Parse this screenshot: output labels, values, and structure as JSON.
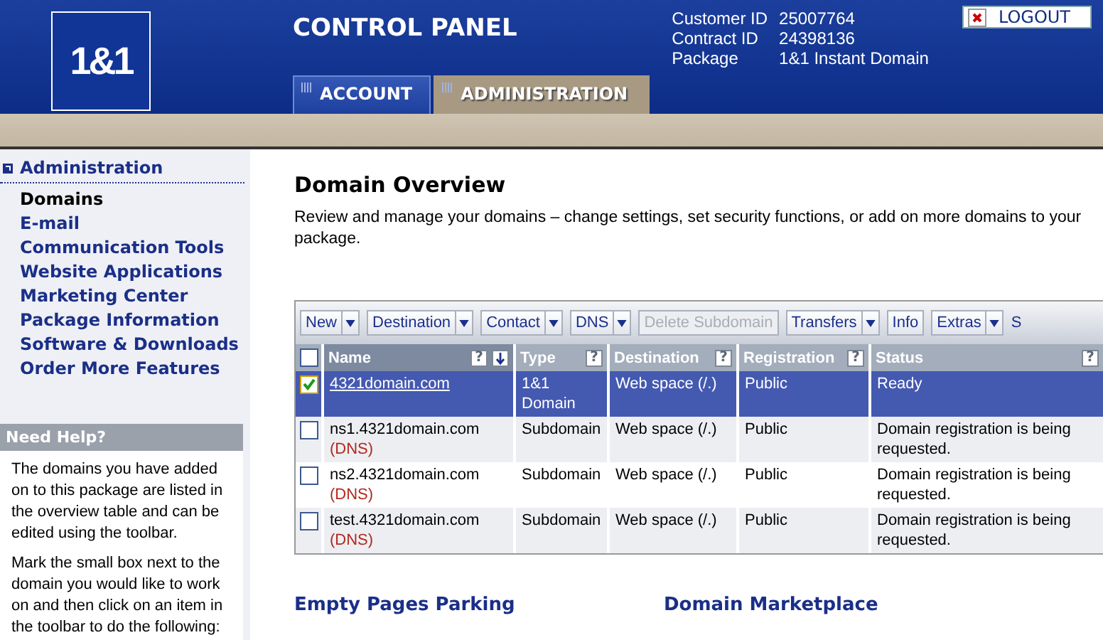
{
  "logo": {
    "text": "1&1"
  },
  "header": {
    "title": "CONTROL PANEL",
    "logout": "LOGOUT",
    "info": [
      {
        "label": "Customer ID",
        "value": "25007764"
      },
      {
        "label": "Contract ID",
        "value": "24398136"
      },
      {
        "label": "Package",
        "value": "1&1 Instant Domain"
      }
    ]
  },
  "tabs": [
    {
      "label": "ACCOUNT",
      "selected": false
    },
    {
      "label": "ADMINISTRATION",
      "selected": true
    }
  ],
  "sidebar": {
    "heading": "Administration",
    "items": [
      {
        "label": "Domains",
        "selected": true
      },
      {
        "label": "E-mail",
        "selected": false
      },
      {
        "label": "Communication Tools",
        "selected": false
      },
      {
        "label": "Website Applications",
        "selected": false
      },
      {
        "label": "Marketing Center",
        "selected": false
      },
      {
        "label": "Package Information",
        "selected": false
      },
      {
        "label": "Software & Downloads",
        "selected": false
      },
      {
        "label": "Order More Features",
        "selected": false
      }
    ],
    "help": {
      "title": "Need Help?",
      "paragraphs": [
        "The domains you have added on to this package are listed in the overview table and can be edited using the toolbar.",
        "Mark the small box next to the domain you would like to work on and then click on an item in the toolbar to do the following:"
      ]
    }
  },
  "main": {
    "title": "Domain Overview",
    "description": "Review and manage your domains – change settings, set security functions, or add on more domains to your package.",
    "toolbar": [
      {
        "kind": "button",
        "label": "New",
        "dropdown": true,
        "disabled": false
      },
      {
        "kind": "button",
        "label": "Destination",
        "dropdown": true,
        "disabled": false
      },
      {
        "kind": "button",
        "label": "Contact",
        "dropdown": true,
        "disabled": false
      },
      {
        "kind": "button",
        "label": "DNS",
        "dropdown": true,
        "disabled": false
      },
      {
        "kind": "button",
        "label": "Delete Subdomain",
        "dropdown": false,
        "disabled": true
      },
      {
        "kind": "button",
        "label": "Transfers",
        "dropdown": true,
        "disabled": false
      },
      {
        "kind": "button",
        "label": "Info",
        "dropdown": false,
        "disabled": false
      },
      {
        "kind": "button",
        "label": "Extras",
        "dropdown": true,
        "disabled": false
      },
      {
        "kind": "cut",
        "label": "S"
      }
    ],
    "table": {
      "all_checked": false,
      "help_glyph": "?",
      "columns": [
        {
          "label": "Name",
          "sort": true,
          "selected": true
        },
        {
          "label": "Type",
          "sort": false,
          "selected": false
        },
        {
          "label": "Destination",
          "sort": false,
          "selected": false
        },
        {
          "label": "Registration",
          "sort": false,
          "selected": false
        },
        {
          "label": "Status",
          "sort": false,
          "selected": false
        }
      ],
      "rows": [
        {
          "checked": true,
          "selected": true,
          "name": "4321domain.com",
          "tag": "",
          "type": "1&1 Domain",
          "destination": "Web space (/.)",
          "registration": "Public",
          "status": "Ready"
        },
        {
          "checked": false,
          "selected": false,
          "name": "ns1.4321domain.com",
          "tag": "(DNS)",
          "type": "Subdomain",
          "destination": "Web space (/.)",
          "registration": "Public",
          "status": "Domain registration is being requested."
        },
        {
          "checked": false,
          "selected": false,
          "name": "ns2.4321domain.com",
          "tag": "(DNS)",
          "type": "Subdomain",
          "destination": "Web space (/.)",
          "registration": "Public",
          "status": "Domain registration is being requested."
        },
        {
          "checked": false,
          "selected": false,
          "name": "test.4321domain.com",
          "tag": "(DNS)",
          "type": "Subdomain",
          "destination": "Web space (/.)",
          "registration": "Public",
          "status": "Domain registration is being requested."
        }
      ]
    },
    "sections": [
      {
        "title": "Empty Pages Parking"
      },
      {
        "title": "Domain Marketplace"
      }
    ]
  }
}
